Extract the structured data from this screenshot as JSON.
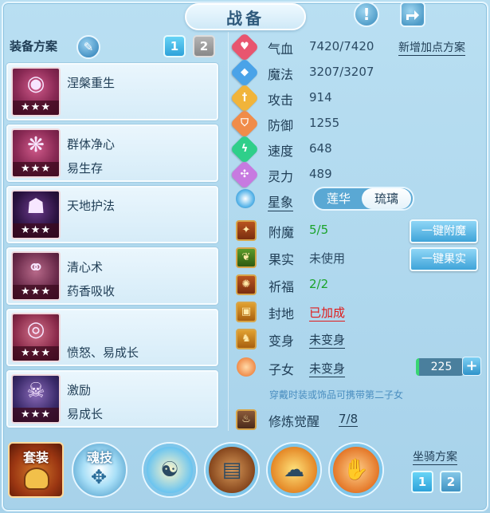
{
  "header": {
    "title": "战备",
    "info_icon": "exclamation-icon",
    "share_icon": "share-icon"
  },
  "left": {
    "plan_label": "装备方案",
    "edit_icon": "pencil-icon",
    "plan_tabs": [
      "1",
      "2"
    ],
    "active_plan": "1",
    "items": [
      {
        "line1": "涅槃重生",
        "line2": "",
        "stars": "★★★",
        "icon": "purple-orb-icon"
      },
      {
        "line1": "群体净心",
        "line2": "易生存",
        "stars": "★★★",
        "icon": "sparkle-branch-icon"
      },
      {
        "line1": "天地护法",
        "line2": "",
        "stars": "★★★",
        "icon": "dark-mask-icon"
      },
      {
        "line1": "清心术",
        "line2": "药香吸收",
        "stars": "★★★",
        "icon": "golden-chain-icon"
      },
      {
        "line1": "",
        "line2": "愤怒、易成长",
        "stars": "★★★",
        "icon": "jeweled-belt-icon"
      },
      {
        "line1": "激励",
        "line2": "易成长",
        "stars": "★★★",
        "icon": "ghost-armor-icon"
      }
    ]
  },
  "stats": {
    "hp": {
      "label": "气血",
      "value": "7420/7420",
      "color": "#e8556f"
    },
    "mp": {
      "label": "魔法",
      "value": "3207/3207",
      "color": "#4aa3e8"
    },
    "atk": {
      "label": "攻击",
      "value": "914",
      "color": "#f1b43a"
    },
    "def": {
      "label": "防御",
      "value": "1255",
      "color": "#f08c4a"
    },
    "spd": {
      "label": "速度",
      "value": "648",
      "color": "#2fcf8a"
    },
    "spi": {
      "label": "灵力",
      "value": "489",
      "color": "#c77ae0"
    },
    "add_points_link": "新增加点方案"
  },
  "constellation": {
    "label": "星象",
    "options": [
      "莲华",
      "琉璃"
    ],
    "selected": "琉璃"
  },
  "extras": {
    "enchant": {
      "label": "附魔",
      "value": "5/5",
      "value_color": "#1aa32a",
      "button": "一键附魔"
    },
    "fruit": {
      "label": "果实",
      "value": "未使用",
      "value_color": "#2b4a63",
      "button": "一键果实"
    },
    "bless": {
      "label": "祈福",
      "value": "2/2",
      "value_color": "#1aa32a"
    },
    "seal": {
      "label": "封地",
      "value": "已加成",
      "value_color": "#e01b1b"
    },
    "transform": {
      "label": "变身",
      "value": "未变身"
    },
    "child": {
      "label": "子女",
      "value": "未变身",
      "counter": "225",
      "plus": "+"
    },
    "hint": "穿戴时装或饰品可携带第二子女",
    "cultivation": {
      "label": "修炼觉醒",
      "value": "7/8"
    }
  },
  "bottom": {
    "set_label": "套装",
    "soul_label": "魂技",
    "mount_label": "坐骑方案",
    "mount_tabs": [
      "1",
      "2"
    ]
  }
}
